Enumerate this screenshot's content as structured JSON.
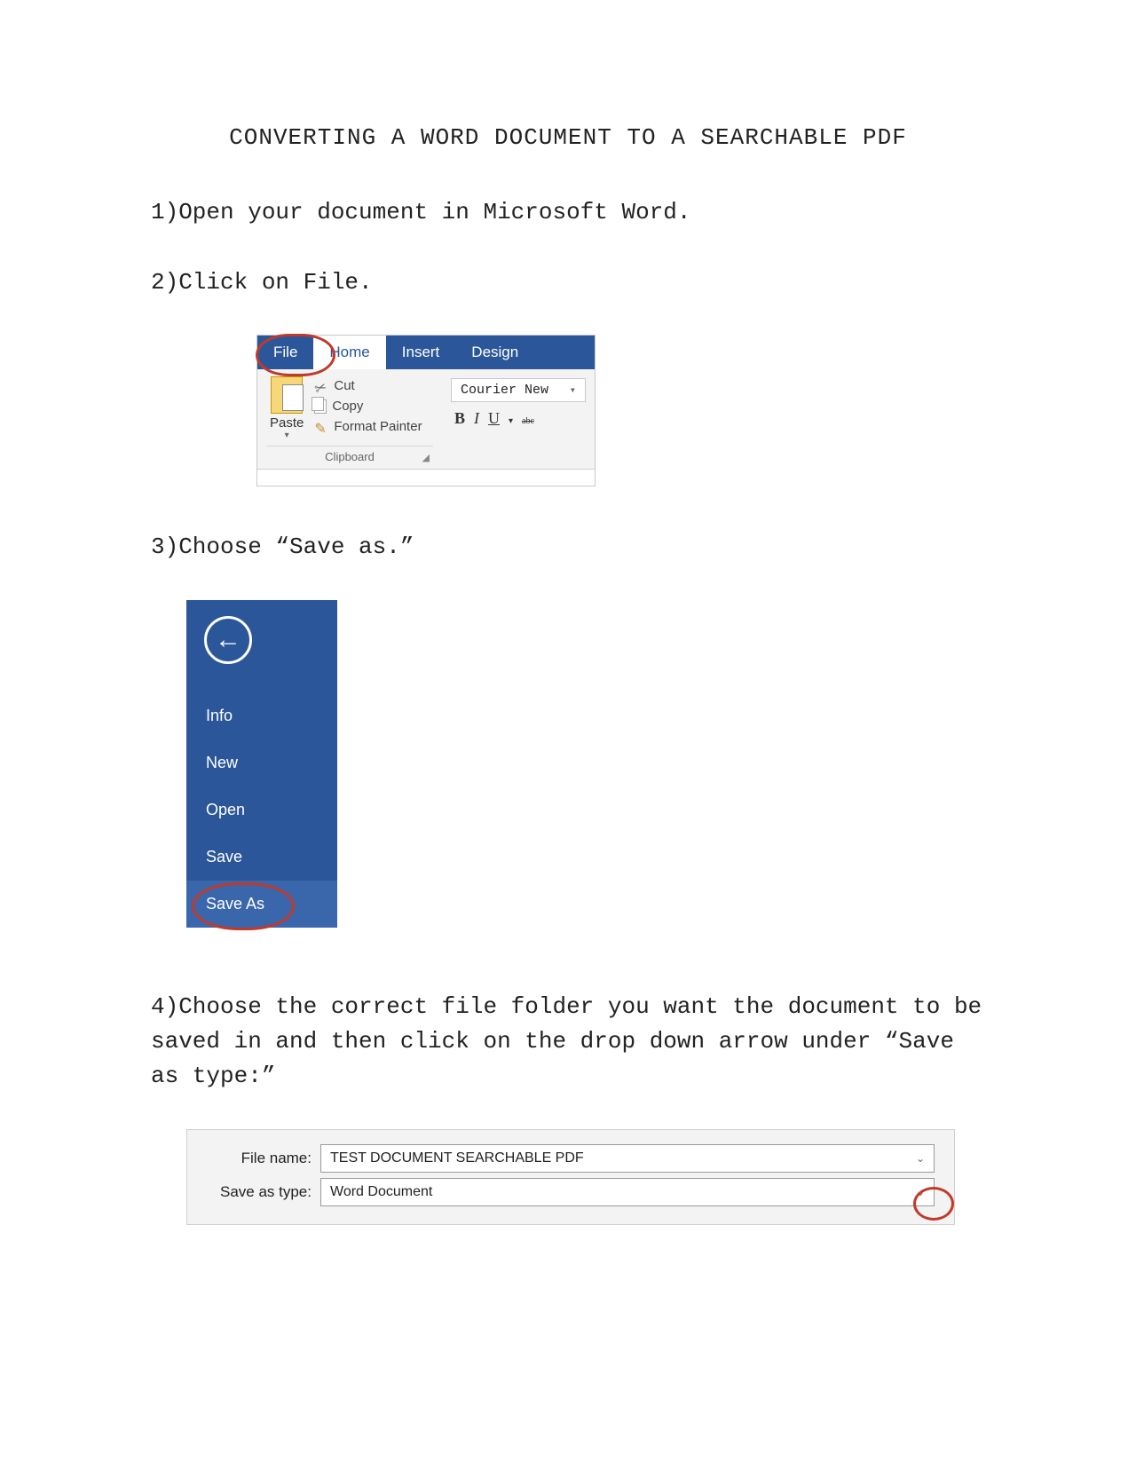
{
  "title": "CONVERTING A WORD DOCUMENT TO A SEARCHABLE PDF",
  "steps": {
    "one": "1)Open your document in Microsoft Word.",
    "two": "2)Click on File.",
    "three": "3)Choose “Save as.”",
    "four": "4)Choose the correct file folder you want the document to be saved in and then click on the drop down arrow under “Save as type:”"
  },
  "ribbon": {
    "tabs": {
      "file": "File",
      "home": "Home",
      "insert": "Insert",
      "design": "Design"
    },
    "paste": "Paste",
    "cut": "Cut",
    "copy": "Copy",
    "format_painter": "Format Painter",
    "clipboard_group": "Clipboard",
    "font_name": "Courier New",
    "b": "B",
    "i": "I",
    "u": "U",
    "abc": "abc"
  },
  "backstage": {
    "info": "Info",
    "new": "New",
    "open": "Open",
    "save": "Save",
    "save_as": "Save As"
  },
  "save_dialog": {
    "file_name_label": "File name:",
    "file_name_value": "TEST DOCUMENT SEARCHABLE PDF",
    "save_as_type_label": "Save as type:",
    "save_as_type_value": "Word Document"
  }
}
